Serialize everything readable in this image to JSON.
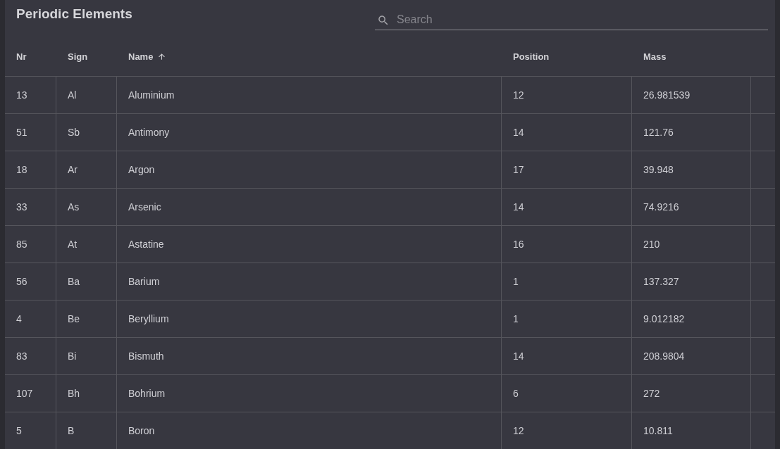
{
  "title": "Periodic Elements",
  "search": {
    "placeholder": "Search"
  },
  "columns": [
    {
      "label": "Nr",
      "sorted": false
    },
    {
      "label": "Sign",
      "sorted": false
    },
    {
      "label": "Name",
      "sorted": true
    },
    {
      "label": "Position",
      "sorted": false
    },
    {
      "label": "Mass",
      "sorted": false
    }
  ],
  "rows": [
    [
      "13",
      "Al",
      "Aluminium",
      "12",
      "26.981539"
    ],
    [
      "51",
      "Sb",
      "Antimony",
      "14",
      "121.76"
    ],
    [
      "18",
      "Ar",
      "Argon",
      "17",
      "39.948"
    ],
    [
      "33",
      "As",
      "Arsenic",
      "14",
      "74.9216"
    ],
    [
      "85",
      "At",
      "Astatine",
      "16",
      "210"
    ],
    [
      "56",
      "Ba",
      "Barium",
      "1",
      "137.327"
    ],
    [
      "4",
      "Be",
      "Beryllium",
      "1",
      "9.012182"
    ],
    [
      "83",
      "Bi",
      "Bismuth",
      "14",
      "208.9804"
    ],
    [
      "107",
      "Bh",
      "Bohrium",
      "6",
      "272"
    ],
    [
      "5",
      "B",
      "Boron",
      "12",
      "10.811"
    ]
  ]
}
